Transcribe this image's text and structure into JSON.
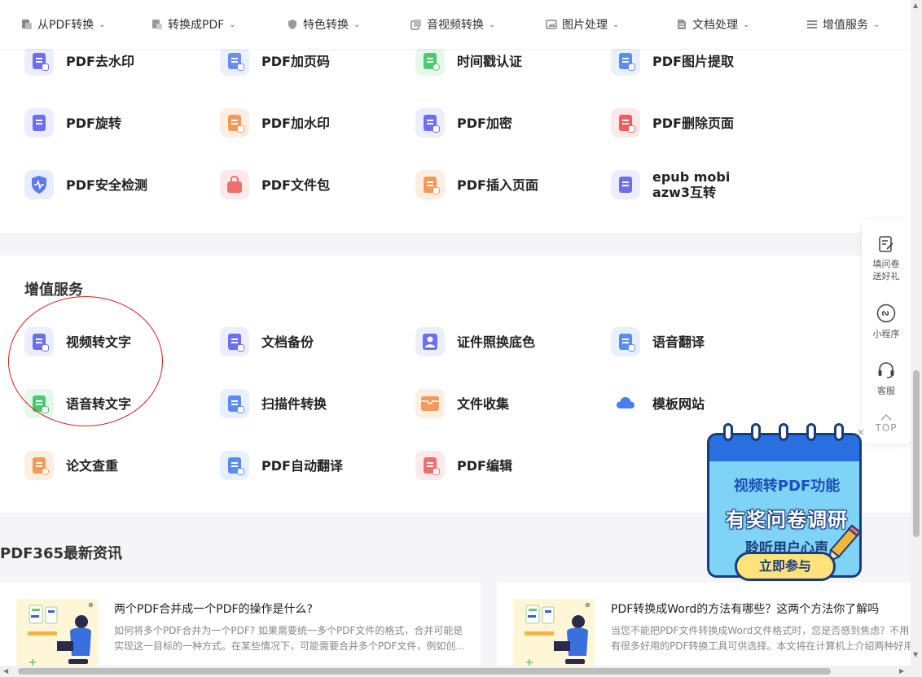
{
  "nav": [
    {
      "label": "从PDF转换",
      "icon": "pdf-icon"
    },
    {
      "label": "转换成PDF",
      "icon": "to-pdf-icon"
    },
    {
      "label": "特色转换",
      "icon": "shield-icon"
    },
    {
      "label": "音视频转换",
      "icon": "media-icon"
    },
    {
      "label": "图片处理",
      "icon": "image-icon"
    },
    {
      "label": "文档处理",
      "icon": "document-icon"
    },
    {
      "label": "增值服务",
      "icon": "list-icon"
    }
  ],
  "tools_top": [
    {
      "label": "PDF去水印",
      "icon": "remove-watermark-icon",
      "color": "#6b6ff0",
      "bg": "#eceefe"
    },
    {
      "label": "PDF加页码",
      "icon": "page-number-icon",
      "color": "#6b8cf0",
      "bg": "#eaf0fe"
    },
    {
      "label": "时间戳认证",
      "icon": "timestamp-icon",
      "color": "#4cc96e",
      "bg": "#e6f8eb"
    },
    {
      "label": "PDF图片提取",
      "icon": "extract-image-icon",
      "color": "#5a8df0",
      "bg": "#e8f0fe"
    },
    {
      "label": "PDF旋转",
      "icon": "rotate-icon",
      "color": "#6b6ff0",
      "bg": "#eceefe"
    },
    {
      "label": "PDF加水印",
      "icon": "add-watermark-icon",
      "color": "#f29a5c",
      "bg": "#fdeee2"
    },
    {
      "label": "PDF加密",
      "icon": "lock-icon",
      "color": "#6b6ff0",
      "bg": "#eceefe"
    },
    {
      "label": "PDF删除页面",
      "icon": "delete-page-icon",
      "color": "#ef5f5f",
      "bg": "#fde8e8"
    },
    {
      "label": "PDF安全检测",
      "icon": "security-check-icon",
      "color": "#5a78f0",
      "bg": "#e8edfe"
    },
    {
      "label": "PDF文件包",
      "icon": "package-icon",
      "color": "#ef6f6f",
      "bg": "#fde9e9"
    },
    {
      "label": "PDF插入页面",
      "icon": "insert-page-icon",
      "color": "#f29a5c",
      "bg": "#fdeee2"
    },
    {
      "label": "epub mobi\nazw3互转",
      "icon": "ebook-icon",
      "color": "#6b6ff0",
      "bg": "#eceefe"
    }
  ],
  "value_section": {
    "title": "增值服务",
    "tools": [
      {
        "label": "视频转文字",
        "icon": "video-to-text-icon",
        "color": "#6b6ff0",
        "bg": "#eceefe"
      },
      {
        "label": "文档备份",
        "icon": "backup-icon",
        "color": "#6b6ff0",
        "bg": "#eceefe"
      },
      {
        "label": "证件照换底色",
        "icon": "id-photo-icon",
        "color": "#6b6ff0",
        "bg": "#eceefe"
      },
      {
        "label": "语音翻译",
        "icon": "voice-translate-icon",
        "color": "#5a8df0",
        "bg": "#e8f0fe"
      },
      {
        "label": "语音转文字",
        "icon": "voice-to-text-icon",
        "color": "#4cc96e",
        "bg": "#e6f8eb"
      },
      {
        "label": "扫描件转换",
        "icon": "scan-icon",
        "color": "#5a8df0",
        "bg": "#e8f0fe"
      },
      {
        "label": "文件收集",
        "icon": "collect-icon",
        "color": "#f29a5c",
        "bg": "#fdeee2"
      },
      {
        "label": "模板网站",
        "icon": "cloud-icon",
        "color": "#4a7ef0",
        "bg": "#ffffff"
      },
      {
        "label": "论文查重",
        "icon": "paper-check-icon",
        "color": "#f29a5c",
        "bg": "#fdeee2"
      },
      {
        "label": "PDF自动翻译",
        "icon": "translate-icon",
        "color": "#5a8df0",
        "bg": "#e8f0fe"
      },
      {
        "label": "PDF编辑",
        "icon": "edit-icon",
        "color": "#ef6f6f",
        "bg": "#fde9e9"
      }
    ]
  },
  "news": {
    "title": "PDF365最新资讯",
    "cards": [
      {
        "headline": "两个PDF合并成一个PDF的操作是什么?",
        "line1": "如何将多个PDF合并为一个PDF? 如果需要统一多个PDF文件的格式，合并可能是",
        "line2": "实现这一目标的一种方式。在某些情况下，可能需要合并多个PDF文件，例如创..."
      },
      {
        "headline": "PDF转换成Word的方法有哪些？这两个方法你了解吗",
        "line1": "当您不能把PDF文件转换成Word文件格式时，您是否感到焦虑？不用",
        "line2": "有很多好用的PDF转换工具可供选择。本文将在计算机上介绍两种好用"
      }
    ]
  },
  "side": [
    {
      "label": "填问卷\n送好礼",
      "icon": "survey-icon"
    },
    {
      "label": "小程序",
      "icon": "mini-program-icon"
    },
    {
      "label": "客服",
      "icon": "headset-icon"
    },
    {
      "label": "TOP",
      "icon": "chevron-up-icon"
    }
  ],
  "promo": {
    "line1": "视频转PDF功能",
    "line2": "有奖问卷调研",
    "line3": "聆听用户心声",
    "button": "立即参与",
    "close": "×"
  }
}
